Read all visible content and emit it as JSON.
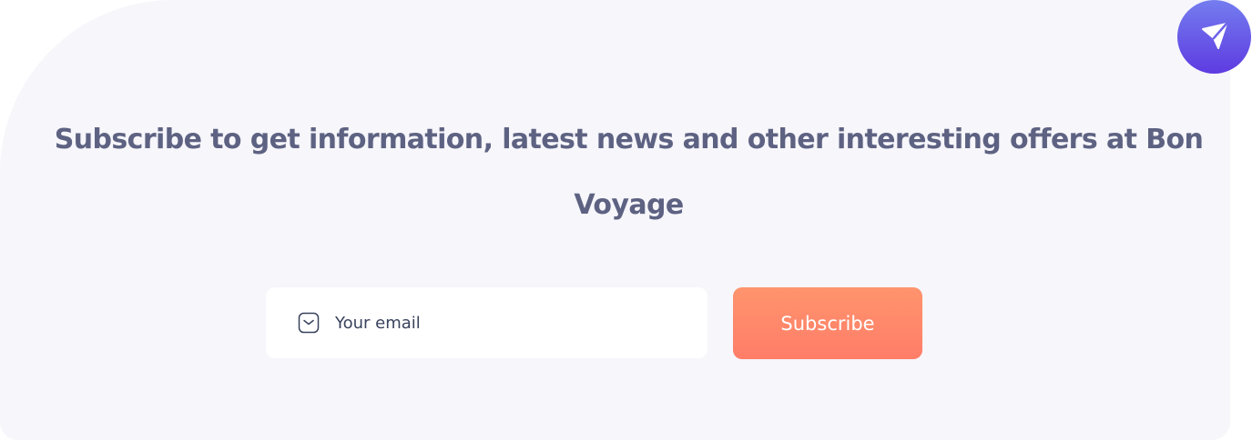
{
  "newsletter": {
    "headline": "Subscribe to get information, latest news and other interesting offers at Bon Voyage",
    "email_placeholder": "Your email",
    "subscribe_label": "Subscribe"
  },
  "icons": {
    "email": "mail-icon",
    "send": "send-icon"
  },
  "colors": {
    "card_background": "#f6f6fb",
    "headline_text": "#5e6282",
    "button_gradient_top": "#ff946d",
    "button_gradient_bottom": "#ff7d68",
    "send_badge_top": "#747def",
    "send_badge_bottom": "#5e3be1"
  }
}
